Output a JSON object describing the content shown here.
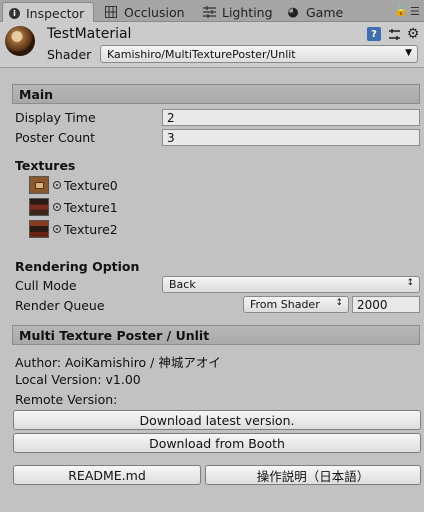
{
  "tabs": [
    {
      "label": "Inspector",
      "icon": "info-icon"
    },
    {
      "label": "Occlusion",
      "icon": "occlusion-icon"
    },
    {
      "label": "Lighting",
      "icon": "lighting-icon"
    },
    {
      "label": "Game",
      "icon": "game-icon"
    }
  ],
  "header": {
    "material_name": "TestMaterial",
    "shader_label": "Shader",
    "shader_value": "Kamishiro/MultiTexturePoster/Unlit"
  },
  "main": {
    "section_title": "Main",
    "display_time_label": "Display Time",
    "display_time_value": "2",
    "poster_count_label": "Poster Count",
    "poster_count_value": "3"
  },
  "textures": {
    "title": "Textures",
    "items": [
      "Texture0",
      "Texture1",
      "Texture2"
    ]
  },
  "rendering": {
    "title": "Rendering Option",
    "cull_mode_label": "Cull Mode",
    "cull_mode_value": "Back",
    "render_queue_label": "Render Queue",
    "render_queue_source": "From Shader",
    "render_queue_value": "2000"
  },
  "about": {
    "section_title": "Multi Texture Poster / Unlit",
    "author": "Author: AoiKamishiro / 神城アオイ",
    "local_version": "Local Version: v1.00",
    "remote_version": "Remote Version:",
    "download_latest": "Download latest version.",
    "download_booth": "Download from Booth",
    "readme": "README.md",
    "manual_jp": "操作説明（日本語）"
  },
  "colors": {
    "background": "#c2c2c2",
    "tab_bar": "#a5a5a5",
    "section_bar": "#b0b0b0",
    "help_icon": "#3b6fb0"
  }
}
